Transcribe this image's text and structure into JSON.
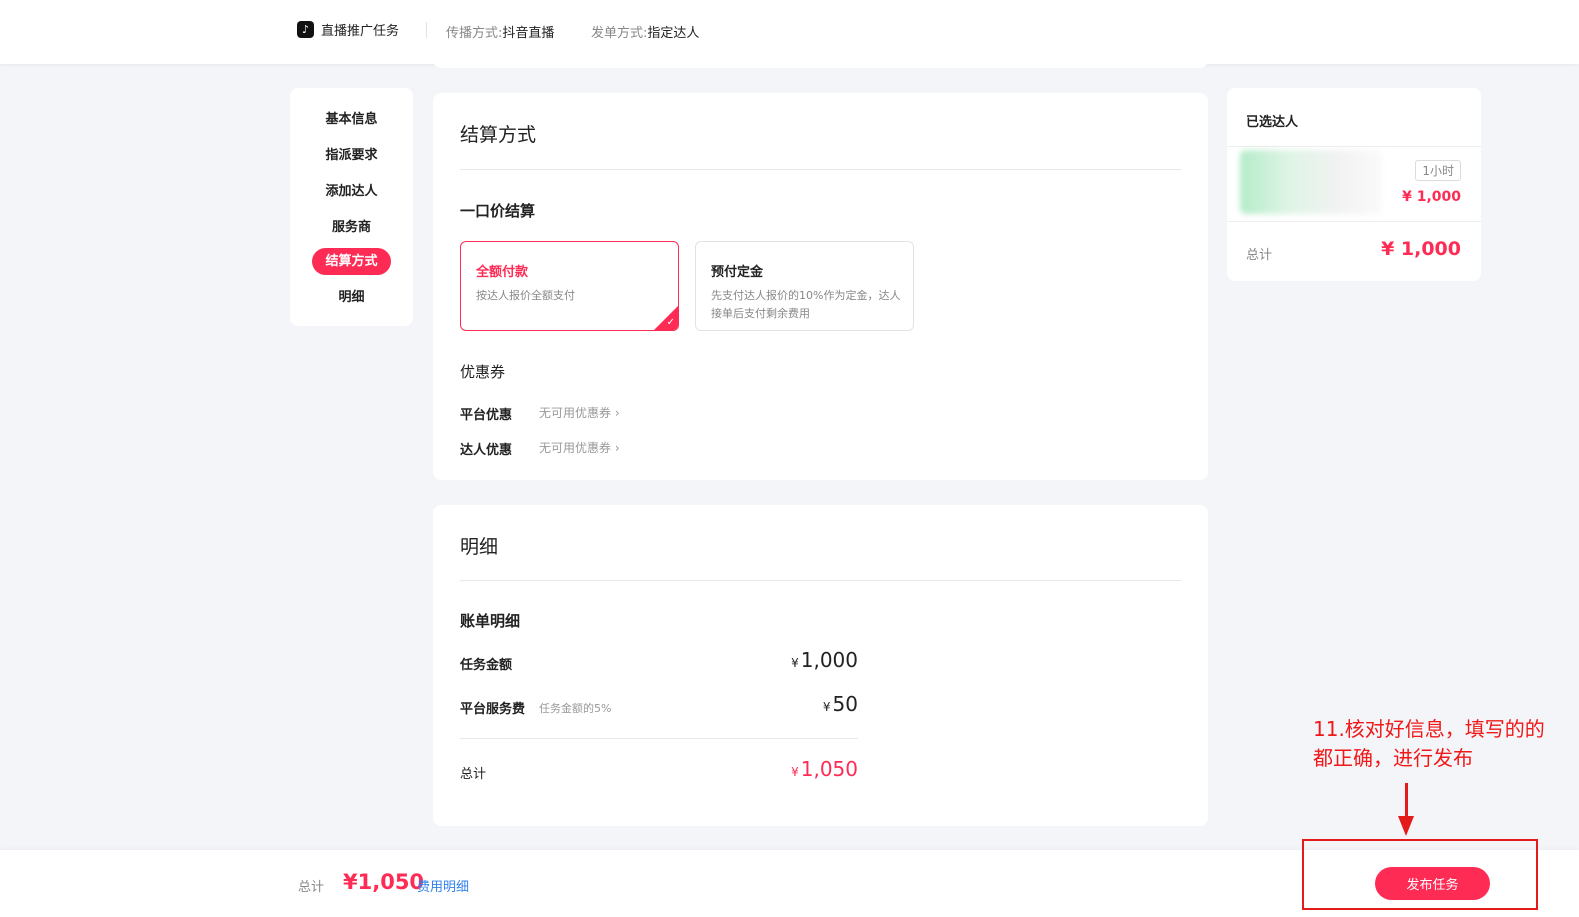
{
  "header": {
    "logo_glyph": "♪",
    "title": "直播推广任务",
    "spread_label": "传播方式:",
    "spread_value": "抖音直播",
    "dispatch_label": "发单方式:",
    "dispatch_value": "指定达人"
  },
  "nav": {
    "items": [
      {
        "label": "基本信息",
        "active": false
      },
      {
        "label": "指派要求",
        "active": false
      },
      {
        "label": "添加达人",
        "active": false
      },
      {
        "label": "服务商",
        "active": false
      },
      {
        "label": "结算方式",
        "active": true
      },
      {
        "label": "明细",
        "active": false
      }
    ]
  },
  "settlement": {
    "title": "结算方式",
    "subtitle": "一口价结算",
    "options": [
      {
        "title": "全额付款",
        "desc": "按达人报价全额支付",
        "selected": true
      },
      {
        "title": "预付定金",
        "desc": "先支付达人报价的10%作为定金，达人接单后支付剩余费用",
        "selected": false
      }
    ],
    "check_glyph": "✓",
    "coupon_title": "优惠券",
    "coupons": [
      {
        "label": "平台优惠",
        "value": "无可用优惠券 ›"
      },
      {
        "label": "达人优惠",
        "value": "无可用优惠券 ›"
      }
    ]
  },
  "detail": {
    "title": "明细",
    "subtitle": "账单明细",
    "currency": "¥",
    "task_label": "任务金额",
    "task_amount": "1,000",
    "fee_label": "平台服务费",
    "fee_note": "任务金额的5%",
    "fee_amount": "50",
    "total_label": "总计",
    "total_amount": "1,050"
  },
  "selected_panel": {
    "title": "已选达人",
    "duration": "1小时",
    "price": "¥ 1,000",
    "total_label": "总计",
    "total": "¥ 1,000"
  },
  "footer": {
    "total_label": "总计",
    "total": "¥1,050",
    "fee_link": "费用明细",
    "publish_label": "发布任务"
  },
  "annotation": {
    "text": "11.核对好信息，填写的的都正确，进行发布",
    "color": "#f01818"
  },
  "colors": {
    "accent": "#fe2c55",
    "link": "#2f80ed",
    "background": "#f4f5f9"
  }
}
